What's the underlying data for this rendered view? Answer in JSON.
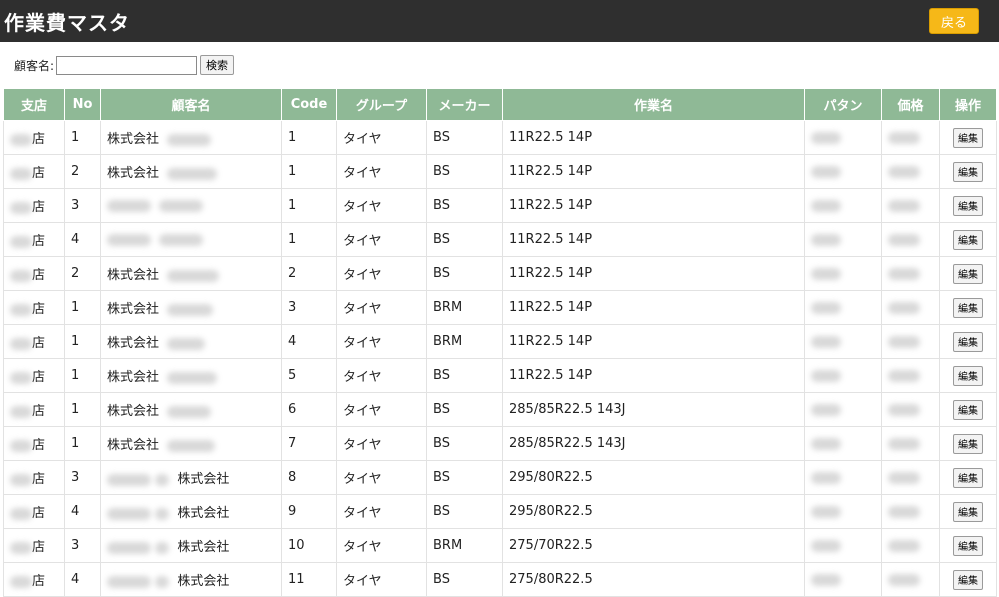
{
  "header": {
    "title": "作業費マスタ",
    "back_label": "戻る"
  },
  "search": {
    "label": "顧客名:",
    "value": "",
    "button_label": "検索"
  },
  "table": {
    "columns": [
      "支店",
      "No",
      "顧客名",
      "Code",
      "グループ",
      "メーカー",
      "作業名",
      "パタン",
      "価格",
      "操作"
    ],
    "edit_label": "編集",
    "rows": [
      {
        "branch": "店",
        "no": "1",
        "customer": "株式会社",
        "customer_pos": "first",
        "code": "1",
        "group": "タイヤ",
        "maker": "BS",
        "work": "11R22.5 14P"
      },
      {
        "branch": "店",
        "no": "2",
        "customer": "株式会社",
        "customer_pos": "first",
        "code": "1",
        "group": "タイヤ",
        "maker": "BS",
        "work": "11R22.5 14P"
      },
      {
        "branch": "店",
        "no": "3",
        "customer": "",
        "customer_pos": "none",
        "code": "1",
        "group": "タイヤ",
        "maker": "BS",
        "work": "11R22.5 14P"
      },
      {
        "branch": "店",
        "no": "4",
        "customer": "",
        "customer_pos": "none",
        "code": "1",
        "group": "タイヤ",
        "maker": "BS",
        "work": "11R22.5 14P"
      },
      {
        "branch": "店",
        "no": "2",
        "customer": "株式会社",
        "customer_pos": "first",
        "code": "2",
        "group": "タイヤ",
        "maker": "BS",
        "work": "11R22.5 14P"
      },
      {
        "branch": "店",
        "no": "1",
        "customer": "株式会社",
        "customer_pos": "first",
        "code": "3",
        "group": "タイヤ",
        "maker": "BRM",
        "work": "11R22.5 14P"
      },
      {
        "branch": "店",
        "no": "1",
        "customer": "株式会社",
        "customer_pos": "first",
        "code": "4",
        "group": "タイヤ",
        "maker": "BRM",
        "work": "11R22.5 14P"
      },
      {
        "branch": "店",
        "no": "1",
        "customer": "株式会社",
        "customer_pos": "first",
        "code": "5",
        "group": "タイヤ",
        "maker": "BS",
        "work": "11R22.5 14P"
      },
      {
        "branch": "店",
        "no": "1",
        "customer": "株式会社",
        "customer_pos": "first",
        "code": "6",
        "group": "タイヤ",
        "maker": "BS",
        "work": "285/85R22.5 143J"
      },
      {
        "branch": "店",
        "no": "1",
        "customer": "株式会社",
        "customer_pos": "first",
        "code": "7",
        "group": "タイヤ",
        "maker": "BS",
        "work": "285/85R22.5 143J"
      },
      {
        "branch": "店",
        "no": "3",
        "customer": "株式会社",
        "customer_pos": "last",
        "code": "8",
        "group": "タイヤ",
        "maker": "BS",
        "work": "295/80R22.5"
      },
      {
        "branch": "店",
        "no": "4",
        "customer": "株式会社",
        "customer_pos": "last",
        "code": "9",
        "group": "タイヤ",
        "maker": "BS",
        "work": "295/80R22.5"
      },
      {
        "branch": "店",
        "no": "3",
        "customer": "株式会社",
        "customer_pos": "last",
        "code": "10",
        "group": "タイヤ",
        "maker": "BRM",
        "work": "275/70R22.5"
      },
      {
        "branch": "店",
        "no": "4",
        "customer": "株式会社",
        "customer_pos": "last",
        "code": "11",
        "group": "タイヤ",
        "maker": "BS",
        "work": "275/80R22.5"
      }
    ]
  },
  "colors": {
    "header_bg": "#2f2f2f",
    "accent": "#f6b818",
    "table_header_bg": "#8fb996"
  }
}
